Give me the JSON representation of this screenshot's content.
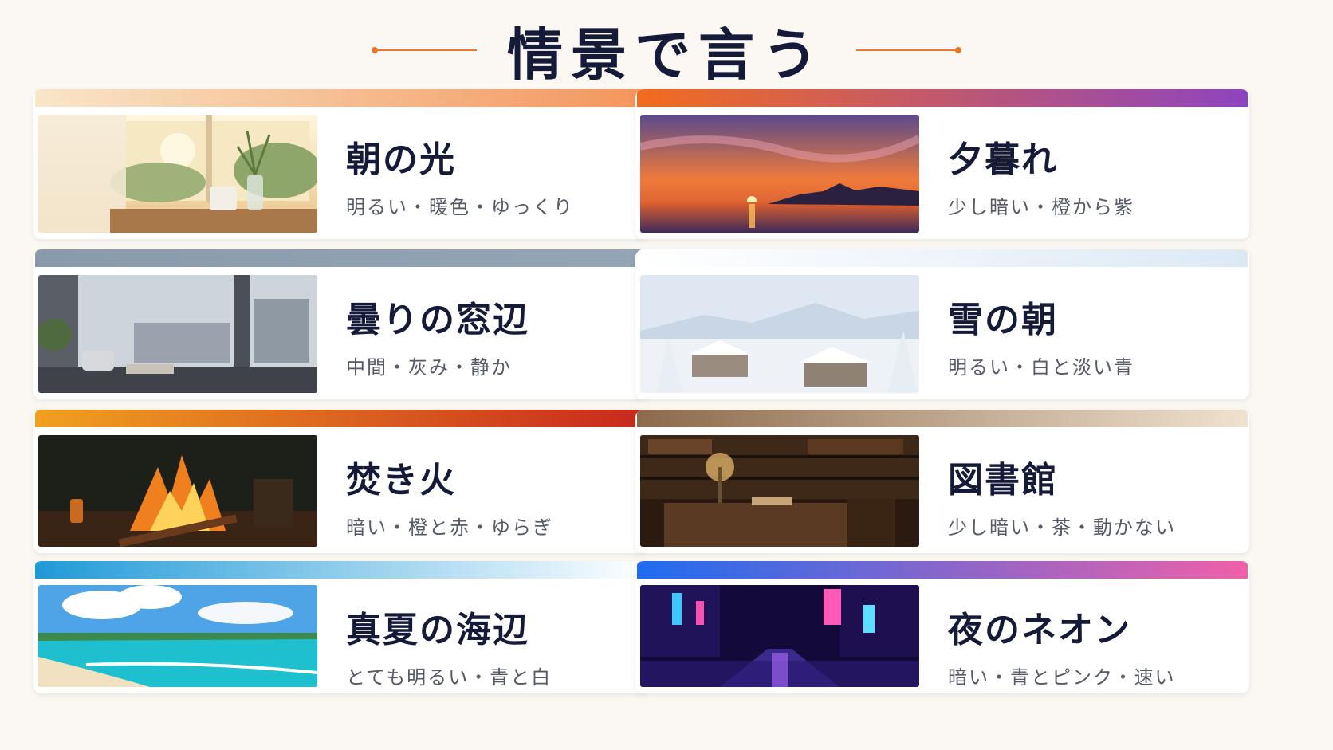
{
  "title": "情景で言う",
  "accent": "#e8782a",
  "cards": [
    {
      "name": "朝の光",
      "desc": "明るい・暖色・ゆっくり",
      "bar_from": "#f8e6c8",
      "bar_to": "#f4955c",
      "image": "morning-window-scene"
    },
    {
      "name": "夕暮れ",
      "desc": "少し暗い・橙から紫",
      "bar_from": "#f26c1e",
      "bar_to": "#8e44c0",
      "image": "sunset-sea-scene"
    },
    {
      "name": "曇りの窓辺",
      "desc": "中間・灰み・静か",
      "bar_from": "#8a9aab",
      "bar_to": "#94a5b6",
      "image": "cloudy-window-scene"
    },
    {
      "name": "雪の朝",
      "desc": "明るい・白と淡い青",
      "bar_from": "#ffffff",
      "bar_to": "#dce9f5",
      "image": "snowy-town-scene"
    },
    {
      "name": "焚き火",
      "desc": "暗い・橙と赤・ゆらぎ",
      "bar_from": "#f0a020",
      "bar_to": "#c8281e",
      "image": "campfire-scene"
    },
    {
      "name": "図書館",
      "desc": "少し暗い・茶・動かない",
      "bar_from": "#8c6a4c",
      "bar_to": "#efe2cf",
      "image": "library-scene"
    },
    {
      "name": "真夏の海辺",
      "desc": "とても明るい・青と白",
      "bar_from": "#1f9ad8",
      "bar_to": "#ffffff",
      "image": "summer-beach-scene"
    },
    {
      "name": "夜のネオン",
      "desc": "暗い・青とピンク・速い",
      "bar_from": "#1e6cf0",
      "bar_to": "#f060a8",
      "image": "neon-street-scene"
    }
  ]
}
